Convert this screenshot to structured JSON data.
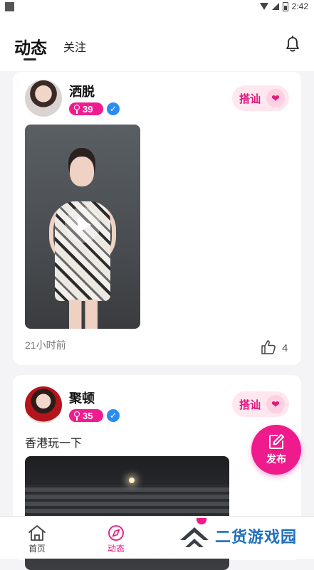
{
  "status_bar": {
    "time": "2:42"
  },
  "header": {
    "tabs": [
      {
        "label": "动态",
        "active": true
      },
      {
        "label": "关注",
        "active": false
      }
    ]
  },
  "posts": [
    {
      "username": "洒脱",
      "level": "39",
      "chat_label": "搭讪",
      "media": "video",
      "time_ago": "21小时前",
      "likes": "4"
    },
    {
      "username": "聚顿",
      "level": "35",
      "chat_label": "搭讪",
      "text": "香港玩一下",
      "media": "photo"
    }
  ],
  "publish": {
    "label": "发布"
  },
  "bottom_nav": {
    "items": [
      {
        "label": "首页",
        "icon": "home-icon"
      },
      {
        "label": "动态",
        "icon": "compass-icon",
        "active": true
      }
    ]
  },
  "watermark": {
    "text": "二货游戏园"
  },
  "colors": {
    "accent": "#ef1a8c",
    "verify": "#2a8cf0",
    "chat_bg": "#ffe6ef"
  }
}
